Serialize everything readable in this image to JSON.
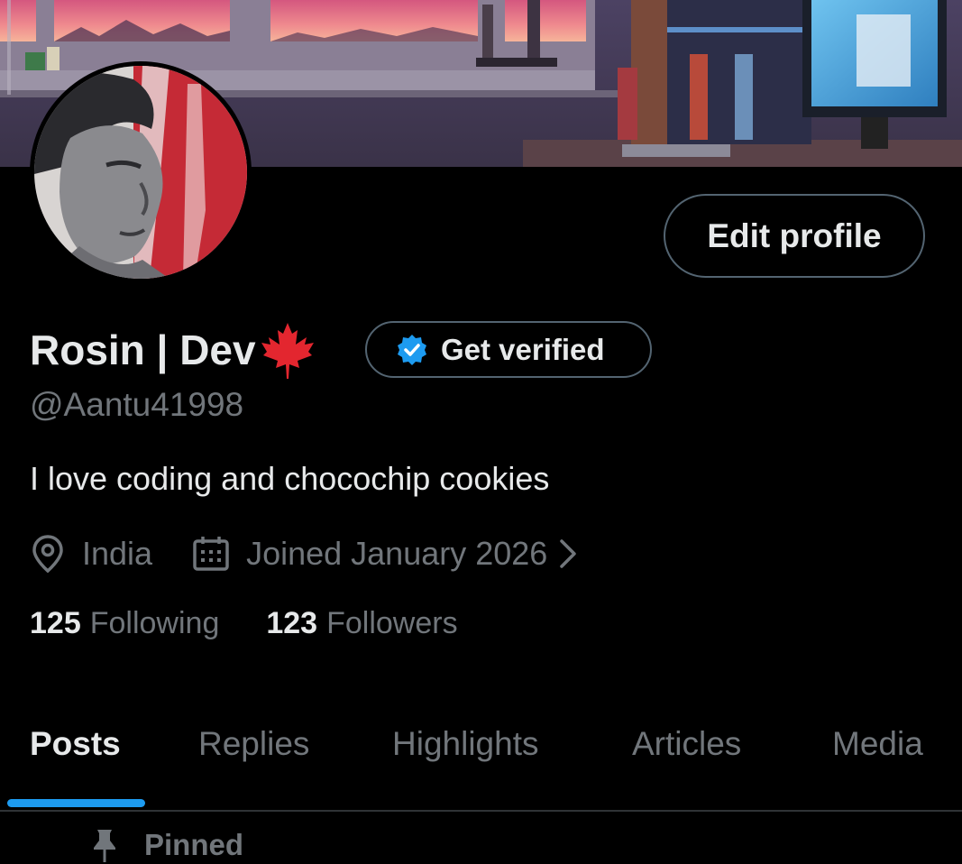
{
  "profile": {
    "display_name": "Rosin | Dev",
    "flag_icon": "maple-leaf-icon",
    "handle": "@Aantu41998",
    "bio": "I love coding and chocochip cookies",
    "location": "India",
    "joined": "Joined January 2026",
    "following_count": "125",
    "following_label": "Following",
    "followers_count": "123",
    "followers_label": "Followers"
  },
  "actions": {
    "edit_profile": "Edit profile",
    "get_verified": "Get verified"
  },
  "tabs": [
    {
      "label": "Posts",
      "active": true
    },
    {
      "label": "Replies",
      "active": false
    },
    {
      "label": "Highlights",
      "active": false
    },
    {
      "label": "Articles",
      "active": false
    },
    {
      "label": "Media",
      "active": false
    }
  ],
  "pinned_label": "Pinned",
  "colors": {
    "background": "#000000",
    "text_primary": "#e7e9ea",
    "text_secondary": "#71767b",
    "accent": "#1d9bf0",
    "border": "#536471",
    "flag_red": "#e3262f"
  }
}
